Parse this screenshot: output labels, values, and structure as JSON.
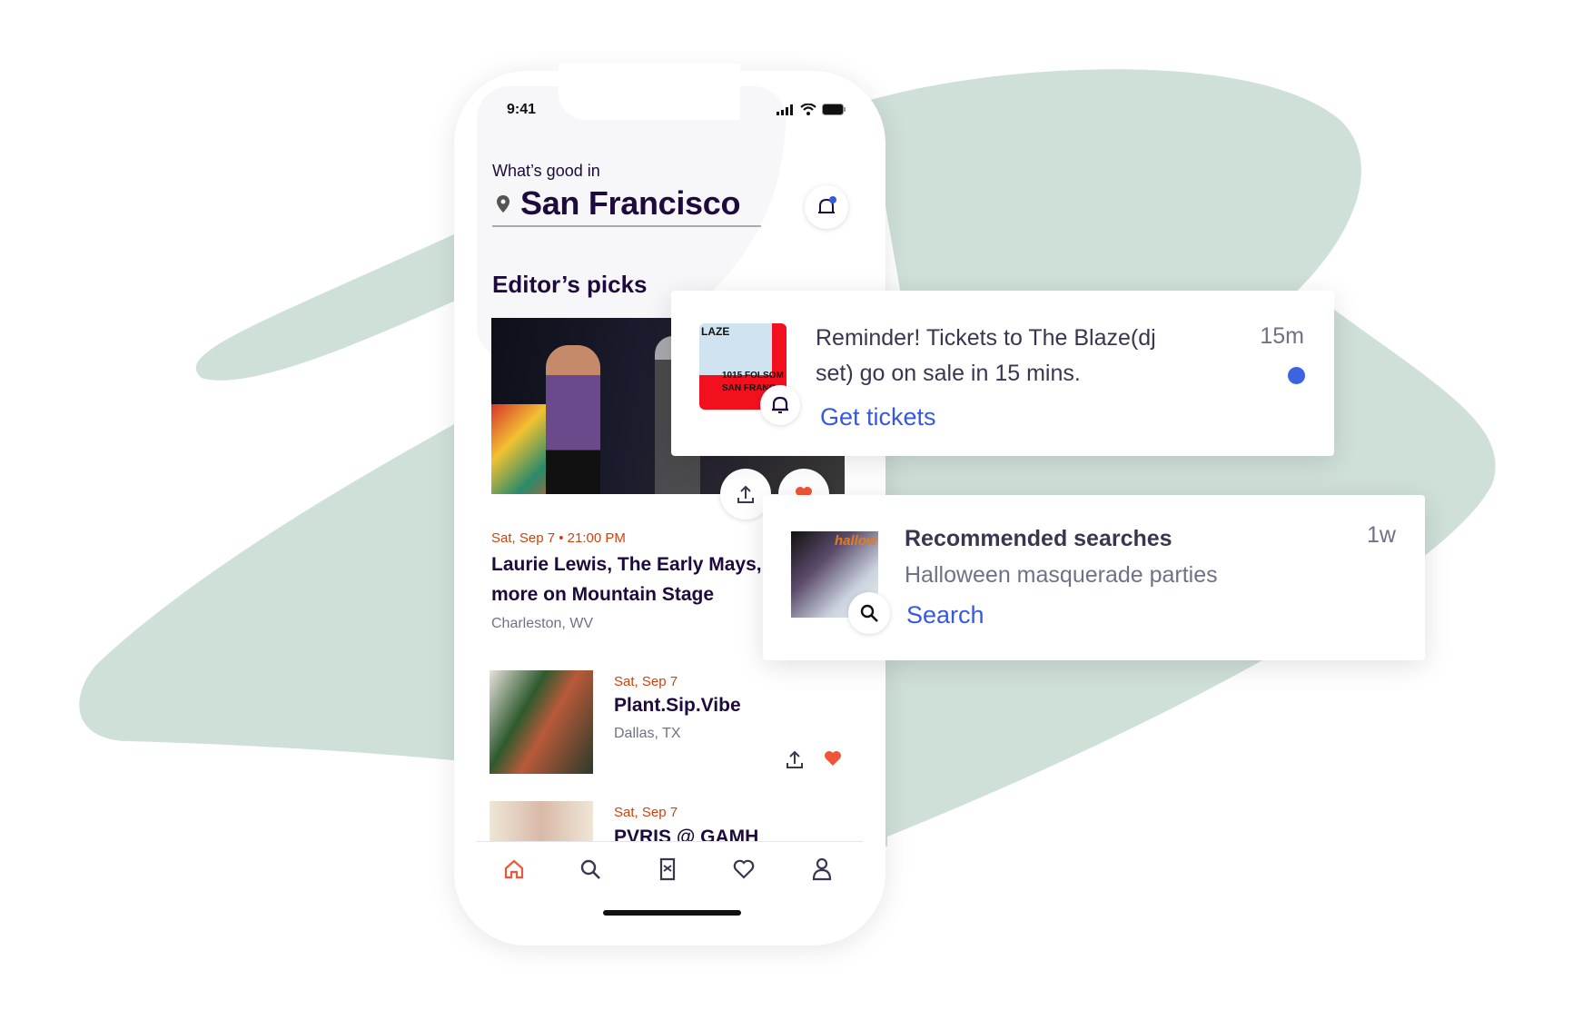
{
  "colors": {
    "background_blob": "#cfe0d8",
    "accent_red": "#d1410c",
    "link_blue": "#3659e3",
    "unread_dot": "#3d64e0",
    "heart": "#f05537"
  },
  "status_bar": {
    "time": "9:41"
  },
  "header": {
    "prompt": "What’s good in",
    "city": "San Francisco",
    "notification_badge": true
  },
  "section": {
    "title": "Editor’s picks"
  },
  "featured": {
    "date": "Sat, Sep 7 • 21:00 PM",
    "title_line1": "Laurie Lewis, The Early Mays,",
    "title_line2": "more on Mountain Stage",
    "location": "Charleston, WV",
    "liked": true
  },
  "events": [
    {
      "date": "Sat, Sep 7",
      "title": "Plant.Sip.Vibe",
      "location": "Dallas, TX",
      "liked": true
    },
    {
      "date": "Sat, Sep 7",
      "title": "PVRIS @ GAMH"
    }
  ],
  "tab_bar": {
    "items": [
      {
        "icon": "home-icon",
        "active": true
      },
      {
        "icon": "search-icon"
      },
      {
        "icon": "ticket-icon"
      },
      {
        "icon": "heart-icon"
      },
      {
        "icon": "profile-icon"
      }
    ]
  },
  "notifications": [
    {
      "thumb_text": [
        "LAZE",
        "1015 FOLSOM",
        "SAN FRANC"
      ],
      "message_line1": "Reminder! Tickets to The Blaze(dj",
      "message_line2": "set) go on sale in 15 mins.",
      "action": "Get tickets",
      "age": "15m",
      "unread": true,
      "badge_icon": "bell-icon"
    },
    {
      "thumb_text": [
        "hallow"
      ],
      "title": "Recommended searches",
      "subtitle": "Halloween masquerade parties",
      "action": "Search",
      "age": "1w",
      "badge_icon": "search-icon"
    }
  ]
}
